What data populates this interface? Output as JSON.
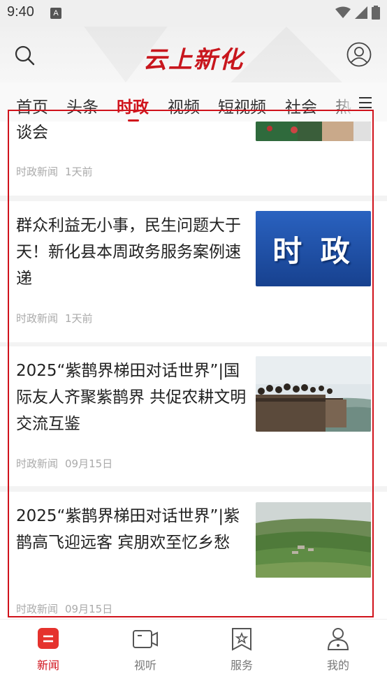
{
  "status": {
    "time": "9:40",
    "notif": "A"
  },
  "header": {
    "logo": "云上新化"
  },
  "tabs": [
    {
      "label": "首页",
      "active": false
    },
    {
      "label": "头条",
      "active": false
    },
    {
      "label": "时政",
      "active": true
    },
    {
      "label": "视频",
      "active": false
    },
    {
      "label": "短视频",
      "active": false
    },
    {
      "label": "社会",
      "active": false
    },
    {
      "label": "热",
      "active": false
    }
  ],
  "feed": [
    {
      "title": "谈会",
      "source": "时政新闻",
      "time": "1天前"
    },
    {
      "title": "群众利益无小事，民生问题大于天！新化县本周政务服务案例速递",
      "source": "时政新闻",
      "time": "1天前",
      "thumb_text": "时 政"
    },
    {
      "title": "2025“紫鹊界梯田对话世界”|国际友人齐聚紫鹊界 共促农耕文明交流互鉴",
      "source": "时政新闻",
      "time": "09月15日"
    },
    {
      "title": "2025“紫鹊界梯田对话世界”|紫鹊高飞迎远客  宾朋欢至忆乡愁",
      "source": "时政新闻",
      "time": "09月15日"
    }
  ],
  "bottom_nav": [
    {
      "label": "新闻",
      "icon": "news-icon",
      "active": true
    },
    {
      "label": "视听",
      "icon": "video-camera-icon",
      "active": false
    },
    {
      "label": "服务",
      "icon": "service-bookmark-icon",
      "active": false
    },
    {
      "label": "我的",
      "icon": "profile-icon",
      "active": false
    }
  ],
  "colors": {
    "accent": "#d0121b",
    "thumb_blue": "#1d4fa8"
  }
}
